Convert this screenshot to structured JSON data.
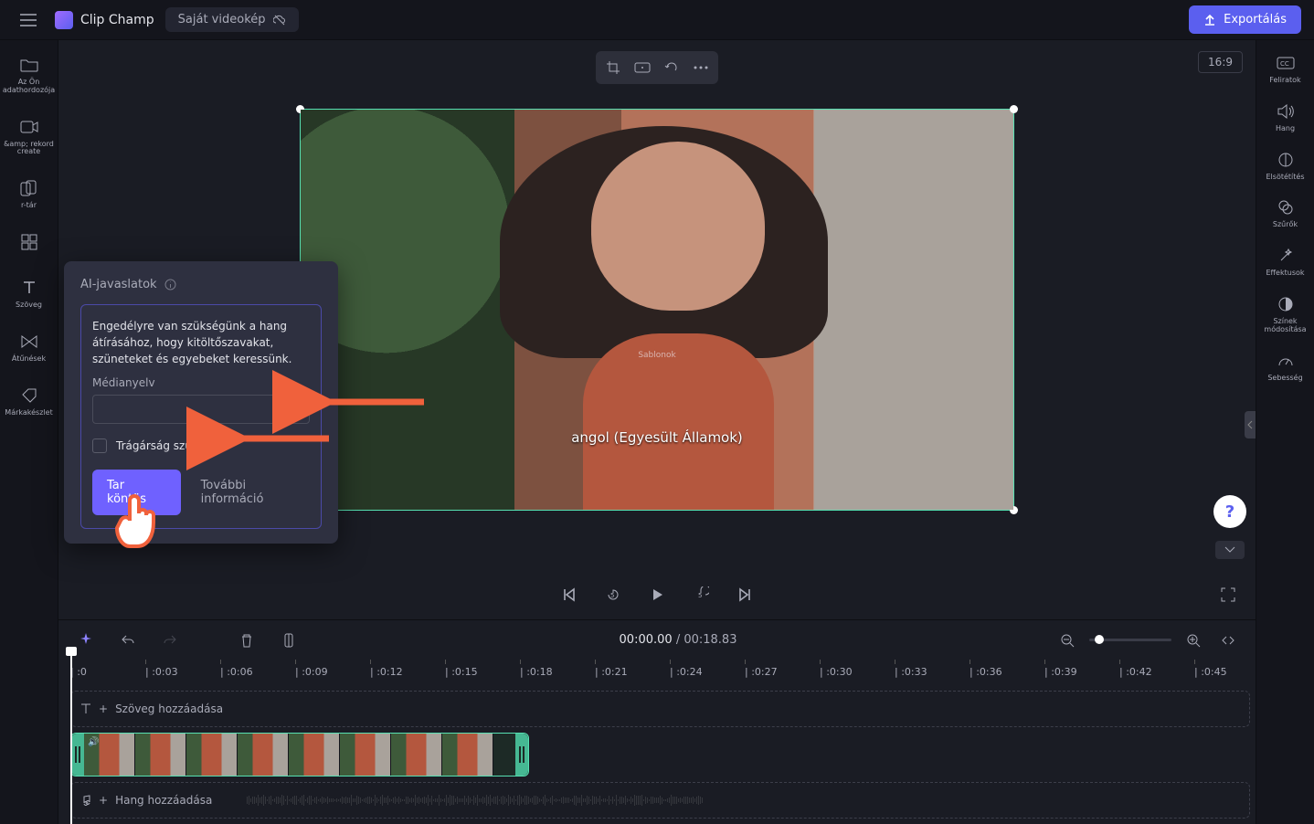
{
  "app": {
    "name": "Clip Champ",
    "project_title": "Saját videokép"
  },
  "header": {
    "export": "Exportálás",
    "aspect_ratio": "16:9"
  },
  "left_sidebar": [
    {
      "id": "media",
      "label": "Az Ön adathordozója"
    },
    {
      "id": "record",
      "label": "&amp; rekord create"
    },
    {
      "id": "library",
      "label": "r-tár"
    },
    {
      "id": "templates",
      "label": ""
    },
    {
      "id": "text",
      "label": "Szöveg"
    },
    {
      "id": "trans",
      "label": "Átűnések"
    },
    {
      "id": "brand",
      "label": "Márkakészlet"
    }
  ],
  "right_sidebar": [
    {
      "id": "captions",
      "label": "Feliratok"
    },
    {
      "id": "audio",
      "label": "Hang"
    },
    {
      "id": "fade",
      "label": "Elsötétítés"
    },
    {
      "id": "filters",
      "label": "Szűrők"
    },
    {
      "id": "effects",
      "label": "Effektusok"
    },
    {
      "id": "colors",
      "label": "Színek módosítása"
    },
    {
      "id": "speed",
      "label": "Sebesség"
    }
  ],
  "preview": {
    "overlay_small": "Sablonok",
    "overlay_lang": "angol (Egyesült Államok)"
  },
  "playback": {
    "current": "00:00.00",
    "total": "00:18.83"
  },
  "ruler_marks": [
    ":0",
    ":0:03",
    ":0:06",
    ":0:09",
    ":0:12",
    ":0:15",
    ":0:18",
    ":0:21",
    ":0:24",
    ":0:27",
    ":0:30",
    ":0:33",
    ":0:36",
    ":0:39",
    ":0:42",
    ":0:45"
  ],
  "tracks": {
    "text_placeholder": "Szöveg hozzáadása",
    "audio_placeholder": "Hang hozzáadása"
  },
  "popup": {
    "title": "AI-javaslatok",
    "body": "Engedélyre van szükségünk a hang átírásához, hogy kitöltőszavakat, szüneteket és egyebeket keressünk.",
    "lang_label": "Médianyelv",
    "filter_profanity": "Trágárság szűrése",
    "primary_btn": "Tar köntös",
    "more_info": "További információ"
  },
  "help": {
    "symbol": "?"
  }
}
